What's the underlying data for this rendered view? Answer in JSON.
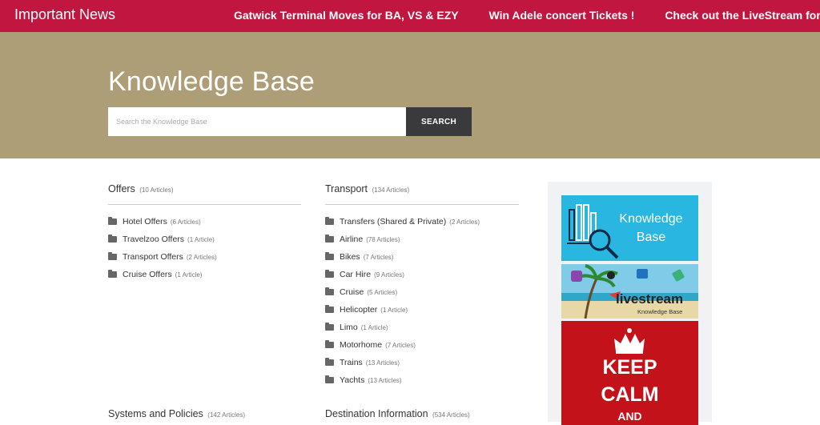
{
  "topbar": {
    "brand": "Important News",
    "ticker": [
      "Gatwick Terminal Moves for BA, VS & EZY",
      "Win Adele concert Tickets !",
      "Check out the LiveStream for key"
    ]
  },
  "hero": {
    "title": "Knowledge Base",
    "search_placeholder": "Search the Knowledge Base",
    "search_button": "SEARCH"
  },
  "categories": [
    {
      "title": "Offers",
      "count": "(10 Articles)",
      "items": [
        {
          "label": "Hotel Offers",
          "count": "(6 Articles)"
        },
        {
          "label": "Travelzoo Offers",
          "count": "(1 Article)"
        },
        {
          "label": "Transport Offers",
          "count": "(2 Articles)"
        },
        {
          "label": "Cruise Offers",
          "count": "(1 Article)"
        }
      ]
    },
    {
      "title": "Transport",
      "count": "(134 Articles)",
      "items": [
        {
          "label": "Transfers (Shared & Private)",
          "count": "(2 Articles)"
        },
        {
          "label": "Airline",
          "count": "(78 Articles)"
        },
        {
          "label": "Bikes",
          "count": "(7 Articles)"
        },
        {
          "label": "Car Hire",
          "count": "(9 Articles)"
        },
        {
          "label": "Cruise",
          "count": "(5 Articles)"
        },
        {
          "label": "Helicopter",
          "count": "(1 Article)"
        },
        {
          "label": "Limo",
          "count": "(1 Article)"
        },
        {
          "label": "Motorhome",
          "count": "(7 Articles)"
        },
        {
          "label": "Trains",
          "count": "(13 Articles)"
        },
        {
          "label": "Yachts",
          "count": "(13 Articles)"
        }
      ]
    }
  ],
  "bottom_categories": [
    {
      "title": "Systems and Policies",
      "count": "(142 Articles)"
    },
    {
      "title": "Destination Information",
      "count": "(534 Articles)"
    }
  ],
  "sidebar": {
    "ad_knowledge": {
      "line1": "Knowledge",
      "line2": "Base"
    },
    "ad_livestream": {
      "brand": "livestream",
      "sub": "Knowledge Base"
    },
    "ad_keepcalm": {
      "line1": "KEEP",
      "line2": "CALM",
      "line3": "AND"
    }
  },
  "colors": {
    "topbar": "#c0163f",
    "hero": "#ae9e77",
    "search_button": "#3a3a3c",
    "ad_blue": "#29b6e0",
    "ad_red": "#c4121b"
  }
}
